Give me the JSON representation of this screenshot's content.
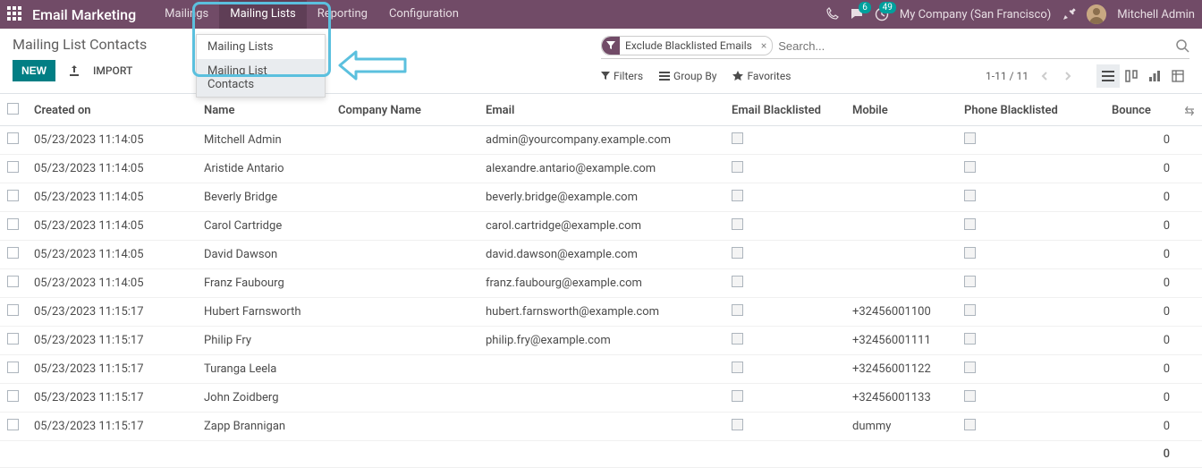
{
  "topbar": {
    "brand": "Email Marketing",
    "menu": [
      "Mailings",
      "Mailing Lists",
      "Reporting",
      "Configuration"
    ],
    "active_menu_index": 1,
    "messages_badge": "6",
    "activities_badge": "49",
    "company": "My Company (San Francisco)",
    "user": "Mitchell Admin"
  },
  "dropdown": {
    "items": [
      "Mailing Lists",
      "Mailing List Contacts"
    ],
    "hover_index": 1
  },
  "breadcrumb": "Mailing List Contacts",
  "buttons": {
    "new": "NEW",
    "import": "IMPORT"
  },
  "search": {
    "facet_label": "Exclude Blacklisted Emails",
    "placeholder": "Search..."
  },
  "filters": {
    "filters": "Filters",
    "group_by": "Group By",
    "favorites": "Favorites"
  },
  "pager": "1-11 / 11",
  "columns": {
    "created_on": "Created on",
    "name": "Name",
    "company_name": "Company Name",
    "email": "Email",
    "email_blacklisted": "Email Blacklisted",
    "mobile": "Mobile",
    "phone_blacklisted": "Phone Blacklisted",
    "bounce": "Bounce"
  },
  "rows": [
    {
      "created": "05/23/2023 11:14:05",
      "name": "Mitchell Admin",
      "company": "",
      "email": "admin@yourcompany.example.com",
      "mobile": "",
      "bounce": "0"
    },
    {
      "created": "05/23/2023 11:14:05",
      "name": "Aristide Antario",
      "company": "",
      "email": "alexandre.antario@example.com",
      "mobile": "",
      "bounce": "0"
    },
    {
      "created": "05/23/2023 11:14:05",
      "name": "Beverly Bridge",
      "company": "",
      "email": "beverly.bridge@example.com",
      "mobile": "",
      "bounce": "0"
    },
    {
      "created": "05/23/2023 11:14:05",
      "name": "Carol Cartridge",
      "company": "",
      "email": "carol.cartridge@example.com",
      "mobile": "",
      "bounce": "0"
    },
    {
      "created": "05/23/2023 11:14:05",
      "name": "David Dawson",
      "company": "",
      "email": "david.dawson@example.com",
      "mobile": "",
      "bounce": "0"
    },
    {
      "created": "05/23/2023 11:14:05",
      "name": "Franz Faubourg",
      "company": "",
      "email": "franz.faubourg@example.com",
      "mobile": "",
      "bounce": "0"
    },
    {
      "created": "05/23/2023 11:15:17",
      "name": "Hubert Farnsworth",
      "company": "",
      "email": "hubert.farnsworth@example.com",
      "mobile": "+32456001100",
      "bounce": "0"
    },
    {
      "created": "05/23/2023 11:15:17",
      "name": "Philip Fry",
      "company": "",
      "email": "philip.fry@example.com",
      "mobile": "+32456001111",
      "bounce": "0"
    },
    {
      "created": "05/23/2023 11:15:17",
      "name": "Turanga Leela",
      "company": "",
      "email": "",
      "mobile": "+32456001122",
      "bounce": "0"
    },
    {
      "created": "05/23/2023 11:15:17",
      "name": "John Zoidberg",
      "company": "",
      "email": "",
      "mobile": "+32456001133",
      "bounce": "0"
    },
    {
      "created": "05/23/2023 11:15:17",
      "name": "Zapp Brannigan",
      "company": "",
      "email": "",
      "mobile": "dummy",
      "bounce": "0"
    }
  ],
  "footer": {
    "bounce_total": "0"
  }
}
